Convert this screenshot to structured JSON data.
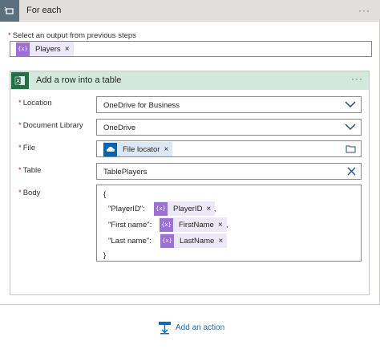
{
  "foreach": {
    "title": "For each",
    "more_label": "···",
    "select_label": "Select an output from previous steps",
    "required_mark": "*",
    "token": {
      "icon": "{x}",
      "label": "Players",
      "remove": "×"
    }
  },
  "action": {
    "title": "Add a row into a table",
    "more_label": "···",
    "fields": {
      "location": {
        "label": "Location",
        "value": "OneDrive for Business"
      },
      "library": {
        "label": "Document Library",
        "value": "OneDrive"
      },
      "file": {
        "label": "File",
        "token_label": "File locator",
        "remove": "×"
      },
      "table": {
        "label": "Table",
        "value": "TablePlayers"
      },
      "body": {
        "label": "Body",
        "open": "{",
        "close": "}",
        "rows": [
          {
            "key": "\"PlayerID\":",
            "token": "PlayerID",
            "suffix": ","
          },
          {
            "key": "\"First name\":",
            "token": "FirstName",
            "suffix": ","
          },
          {
            "key": "\"Last name\":",
            "token": "LastName",
            "suffix": ""
          }
        ]
      }
    }
  },
  "add_action": {
    "label": "Add an action"
  },
  "colors": {
    "accent": "#0f6cbd",
    "token_icon": "#9b6fdc",
    "excel": "#217346",
    "onedrive": "#0364b8"
  }
}
